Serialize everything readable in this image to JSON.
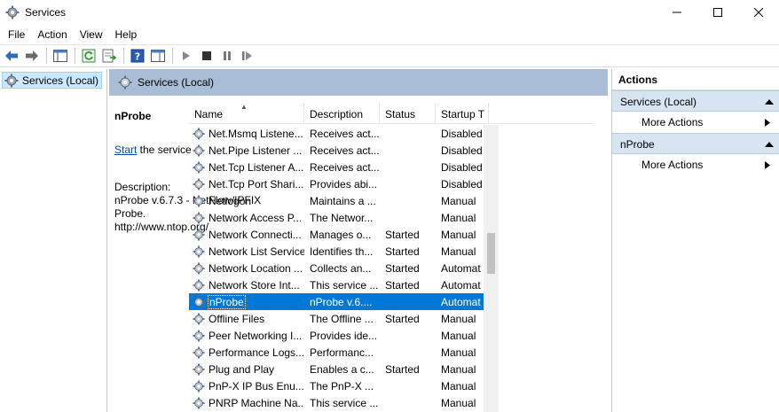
{
  "window": {
    "title": "Services"
  },
  "menu": [
    "File",
    "Action",
    "View",
    "Help"
  ],
  "tree": {
    "root_label": "Services (Local)"
  },
  "center": {
    "header": "Services (Local)",
    "selected_service": "nProbe",
    "start_link": "Start",
    "start_suffix": " the service",
    "description_label": "Description:",
    "description_line1": "nProbe v.6.7.3 - NetFlow/IPFIX Probe.",
    "description_line2": "http://www.ntop.org/"
  },
  "list": {
    "columns": {
      "name": "Name",
      "description": "Description",
      "status": "Status",
      "startup": "Startup T"
    },
    "rows": [
      {
        "name": "Net.Msmq Listene...",
        "description": "Receives act...",
        "status": "",
        "startup": "Disabled"
      },
      {
        "name": "Net.Pipe Listener ...",
        "description": "Receives act...",
        "status": "",
        "startup": "Disabled"
      },
      {
        "name": "Net.Tcp Listener A...",
        "description": "Receives act...",
        "status": "",
        "startup": "Disabled"
      },
      {
        "name": "Net.Tcp Port Shari...",
        "description": "Provides abi...",
        "status": "",
        "startup": "Disabled"
      },
      {
        "name": "Netlogon",
        "description": "Maintains a ...",
        "status": "",
        "startup": "Manual"
      },
      {
        "name": "Network Access P...",
        "description": "The Networ...",
        "status": "",
        "startup": "Manual"
      },
      {
        "name": "Network Connecti...",
        "description": "Manages o...",
        "status": "Started",
        "startup": "Manual"
      },
      {
        "name": "Network List Service",
        "description": "Identifies th...",
        "status": "Started",
        "startup": "Manual"
      },
      {
        "name": "Network Location ...",
        "description": "Collects an...",
        "status": "Started",
        "startup": "Automat"
      },
      {
        "name": "Network Store Int...",
        "description": "This service ...",
        "status": "Started",
        "startup": "Automat"
      },
      {
        "name": "nProbe",
        "description": "nProbe v.6....",
        "status": "",
        "startup": "Automat"
      },
      {
        "name": "Offline Files",
        "description": "The Offline ...",
        "status": "Started",
        "startup": "Manual"
      },
      {
        "name": "Peer Networking I...",
        "description": "Provides ide...",
        "status": "",
        "startup": "Manual"
      },
      {
        "name": "Performance Logs...",
        "description": "Performanc...",
        "status": "",
        "startup": "Manual"
      },
      {
        "name": "Plug and Play",
        "description": "Enables a c...",
        "status": "Started",
        "startup": "Manual"
      },
      {
        "name": "PnP-X IP Bus Enu...",
        "description": "The PnP-X ...",
        "status": "",
        "startup": "Manual"
      },
      {
        "name": "PNRP Machine Na...",
        "description": "This service ...",
        "status": "",
        "startup": "Manual"
      }
    ],
    "selected_index": 10
  },
  "actions": {
    "title": "Actions",
    "sections": [
      {
        "label": "Services (Local)",
        "item": "More Actions"
      },
      {
        "label": "nProbe",
        "item": "More Actions"
      }
    ]
  },
  "colors": {
    "selection": "#0078d7",
    "header_band": "#a9bdd6",
    "action_section": "#d7e4f2"
  }
}
